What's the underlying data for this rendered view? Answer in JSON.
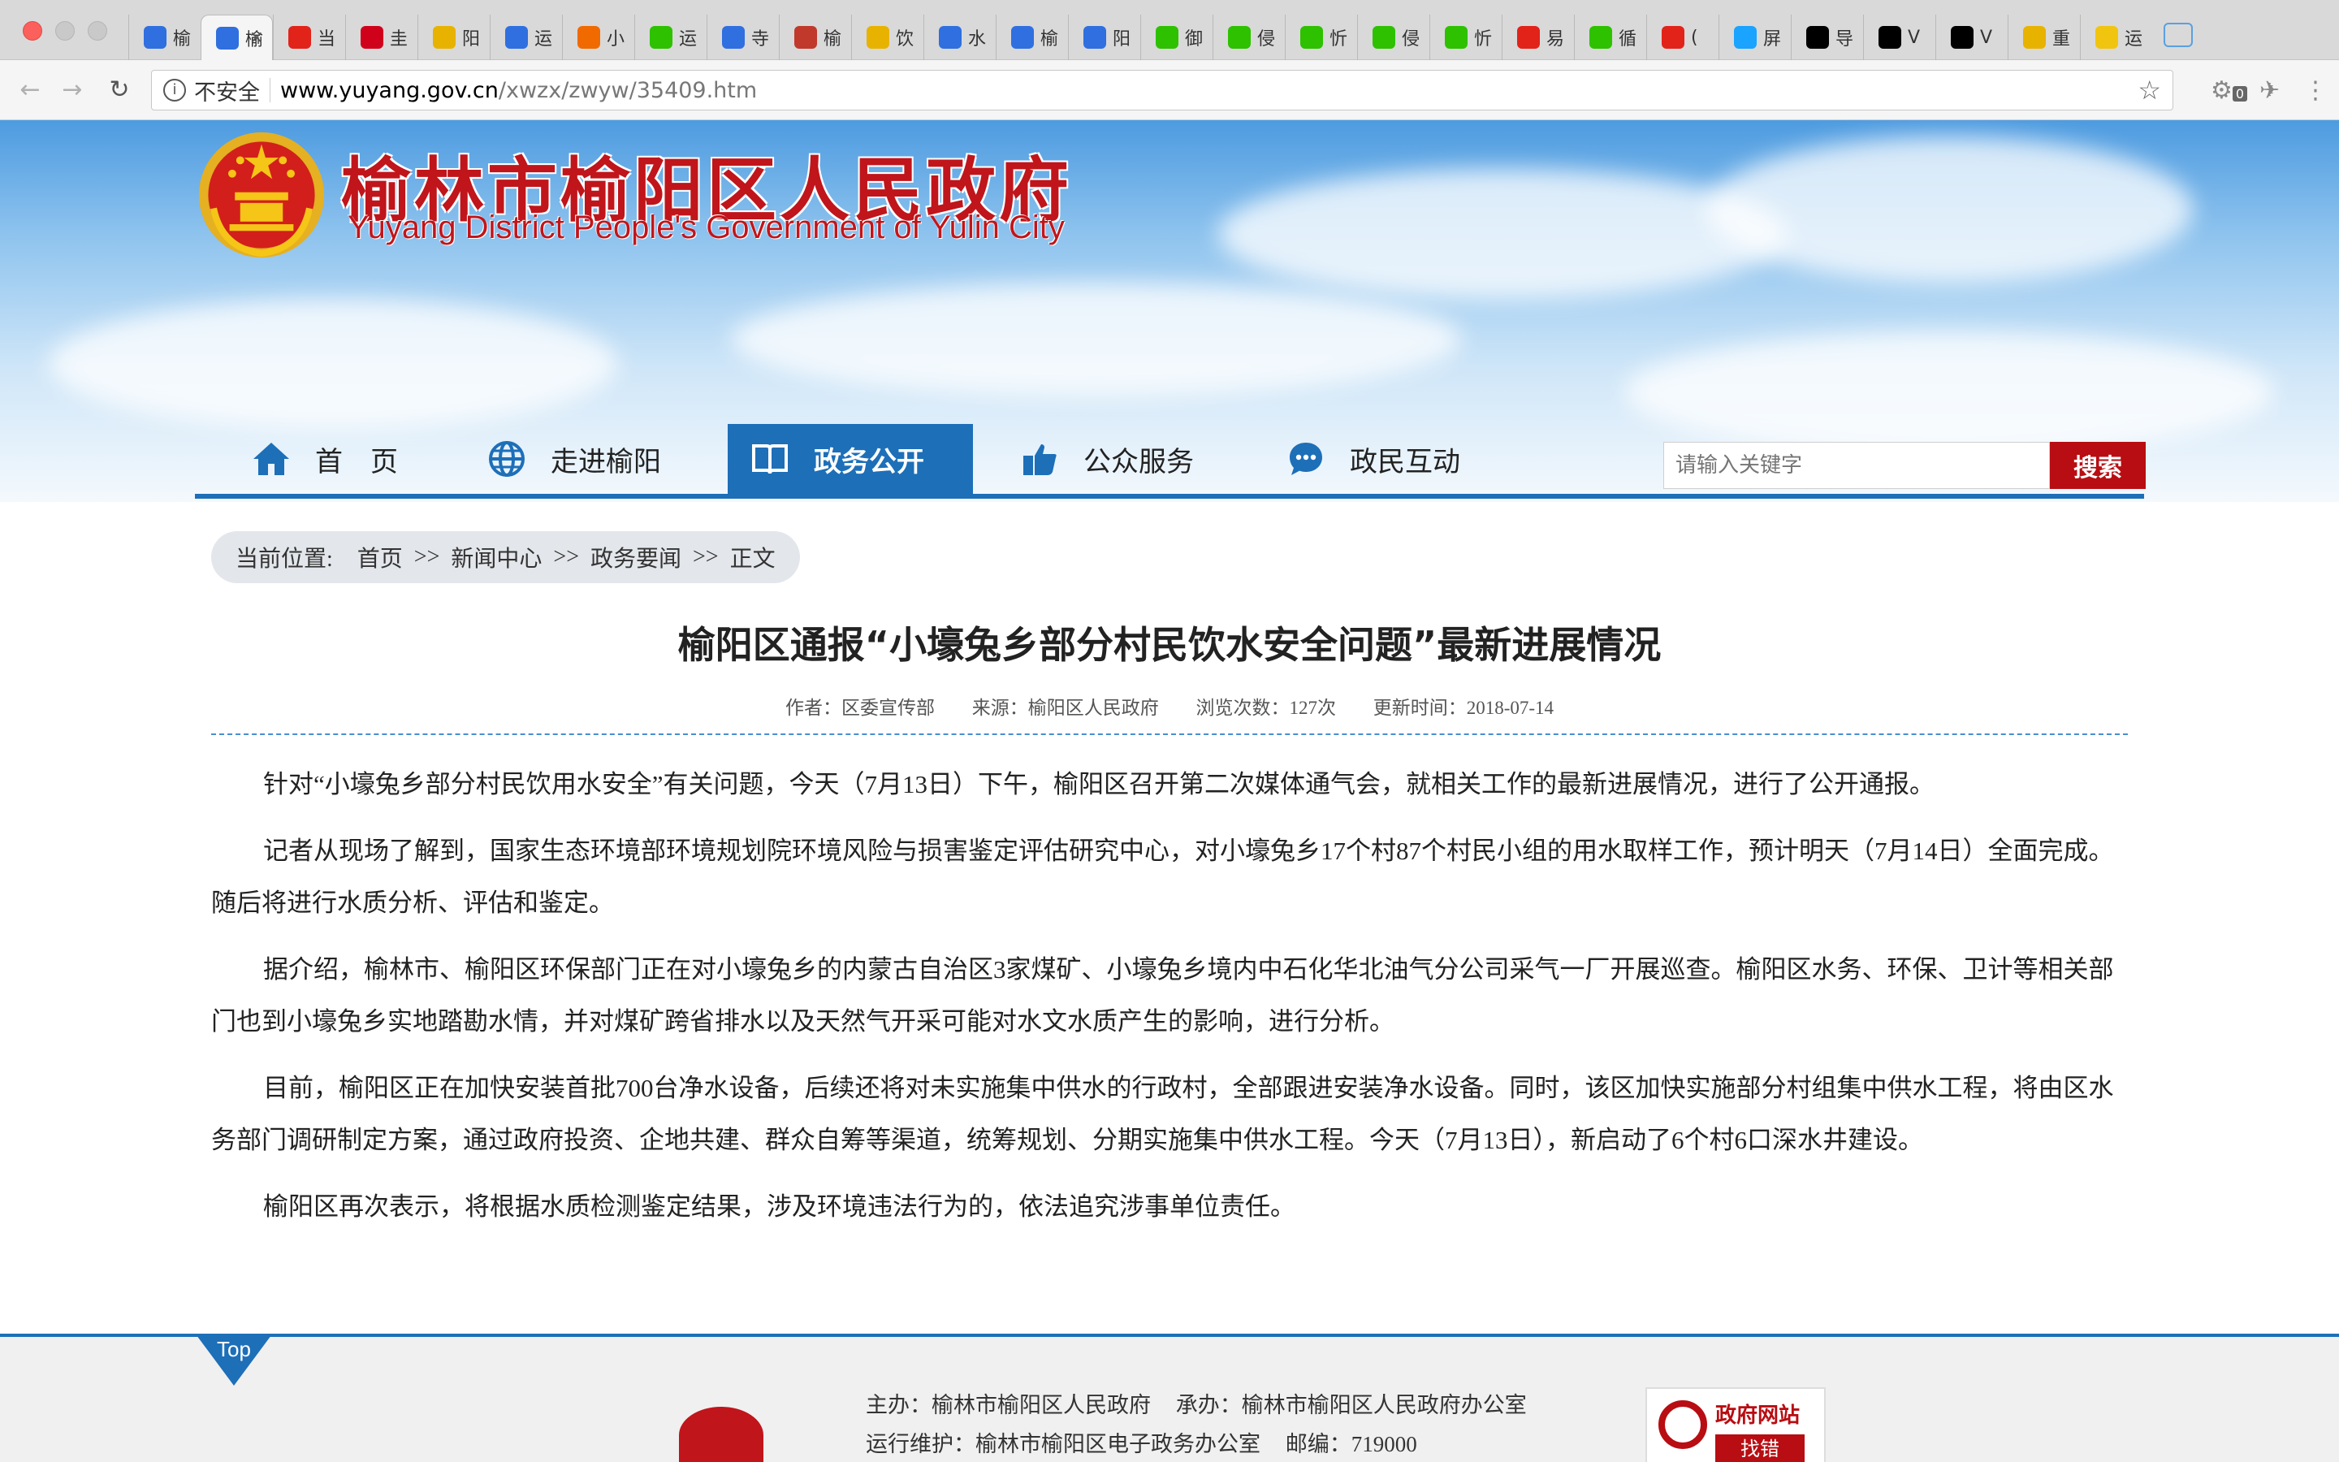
{
  "browser": {
    "tabs": [
      {
        "icon": "paw-icon",
        "color": "#2f6fe0",
        "label": "榆"
      },
      {
        "icon": "paw-icon",
        "color": "#2f6fe0",
        "label": "榆",
        "active": true
      },
      {
        "icon": "weibo-icon",
        "color": "#e2231a",
        "label": "当"
      },
      {
        "icon": "news-icon",
        "color": "#d0021b",
        "label": "圭"
      },
      {
        "icon": "sogou-icon",
        "color": "#e8b200",
        "label": "阳"
      },
      {
        "icon": "paw-icon",
        "color": "#2f6fe0",
        "label": "运"
      },
      {
        "icon": "sogou-icon",
        "color": "#f06a00",
        "label": "小"
      },
      {
        "icon": "wechat-icon",
        "color": "#2dc100",
        "label": "运"
      },
      {
        "icon": "paw-icon",
        "color": "#2f6fe0",
        "label": "寺"
      },
      {
        "icon": "mask-icon",
        "color": "#c0392b",
        "label": "榆"
      },
      {
        "icon": "sogou-icon",
        "color": "#e8b200",
        "label": "饮"
      },
      {
        "icon": "paw-icon",
        "color": "#2f6fe0",
        "label": "水"
      },
      {
        "icon": "link-icon",
        "color": "#2f6fe0",
        "label": "榆"
      },
      {
        "icon": "paw-icon",
        "color": "#2f6fe0",
        "label": "阳"
      },
      {
        "icon": "wechat-icon",
        "color": "#2dc100",
        "label": "御"
      },
      {
        "icon": "wechat-icon",
        "color": "#2dc100",
        "label": "侵"
      },
      {
        "icon": "wechat-icon",
        "color": "#2dc100",
        "label": "忻"
      },
      {
        "icon": "wechat-icon",
        "color": "#2dc100",
        "label": "侵"
      },
      {
        "icon": "wechat-icon",
        "color": "#2dc100",
        "label": "忻"
      },
      {
        "icon": "yi-icon",
        "color": "#e2231a",
        "label": "易"
      },
      {
        "icon": "wechat-icon",
        "color": "#2dc100",
        "label": "循"
      },
      {
        "icon": "yi-icon",
        "color": "#e2231a",
        "label": "("
      },
      {
        "icon": "play-icon",
        "color": "#1aa3ff",
        "label": "屏"
      },
      {
        "icon": "vice-icon",
        "color": "#000000",
        "label": "导"
      },
      {
        "icon": "vice-icon",
        "color": "#000000",
        "label": "V"
      },
      {
        "icon": "vice-icon",
        "color": "#000000",
        "label": "V"
      },
      {
        "icon": "sogou-icon",
        "color": "#e8b200",
        "label": "重"
      },
      {
        "icon": "circle-icon",
        "color": "#f1c40f",
        "label": "运"
      }
    ],
    "close_glyph": "×",
    "security_text": "不安全",
    "url_host": "www.yuyang.gov.cn",
    "url_path": "/xwzx/zwyw/35409.htm",
    "ext_badge": "0"
  },
  "header": {
    "title": "榆林市榆阳区人民政府",
    "subtitle": "Yuyang District People's Government of Yulin City"
  },
  "nav": {
    "items": [
      {
        "label": "首　页",
        "icon": "home-icon"
      },
      {
        "label": "走进榆阳",
        "icon": "globe-icon"
      },
      {
        "label": "政务公开",
        "icon": "book-icon",
        "active": true
      },
      {
        "label": "公众服务",
        "icon": "pointing-hand-icon"
      },
      {
        "label": "政民互动",
        "icon": "chat-bubble-icon"
      }
    ],
    "search_placeholder": "请输入关键字",
    "search_button": "搜索"
  },
  "breadcrumb": {
    "label": "当前位置:",
    "items": [
      "首页",
      "新闻中心",
      "政务要闻",
      "正文"
    ],
    "separator": ">>"
  },
  "article": {
    "title": "榆阳区通报“小壕兔乡部分村民饮水安全问题”最新进展情况",
    "meta": {
      "author": "作者：区委宣传部",
      "source": "来源：榆阳区人民政府",
      "views": "浏览次数：127次",
      "updated": "更新时间：2018-07-14"
    },
    "paragraphs": [
      "针对“小壕兔乡部分村民饮用水安全”有关问题，今天（7月13日）下午，榆阳区召开第二次媒体通气会，就相关工作的最新进展情况，进行了公开通报。",
      "记者从现场了解到，国家生态环境部环境规划院环境风险与损害鉴定评估研究中心，对小壕兔乡17个村87个村民小组的用水取样工作，预计明天（7月14日）全面完成。随后将进行水质分析、评估和鉴定。",
      "据介绍，榆林市、榆阳区环保部门正在对小壕兔乡的内蒙古自治区3家煤矿、小壕兔乡境内中石化华北油气分公司采气一厂开展巡查。榆阳区水务、环保、卫计等相关部门也到小壕兔乡实地踏勘水情，并对煤矿跨省排水以及天然气开采可能对水文水质产生的影响，进行分析。",
      "目前，榆阳区正在加快安装首批700台净水设备，后续还将对未实施集中供水的行政村，全部跟进安装净水设备。同时，该区加快实施部分村组集中供水工程，将由区水务部门调研制定方案，通过政府投资、企地共建、群众自筹等渠道，统筹规划、分期实施集中供水工程。今天（7月13日），新启动了6个村6口深水井建设。",
      "榆阳区再次表示，将根据水质检测鉴定结果，涉及环境违法行为的，依法追究涉事单位责任。"
    ]
  },
  "footer": {
    "top_label": "Top",
    "host": "主办：榆林市榆阳区人民政府",
    "organizer": "承办：榆林市榆阳区人民政府办公室",
    "maintainer": "运行维护：榆林市榆阳区电子政务办公室",
    "postcode": "邮编：719000",
    "jiucuo_title": "政府网站",
    "jiucuo_button": "找错"
  },
  "colors": {
    "brand_red": "#c0151b",
    "nav_blue": "#1d6fb8",
    "search_red": "#b80d12"
  }
}
